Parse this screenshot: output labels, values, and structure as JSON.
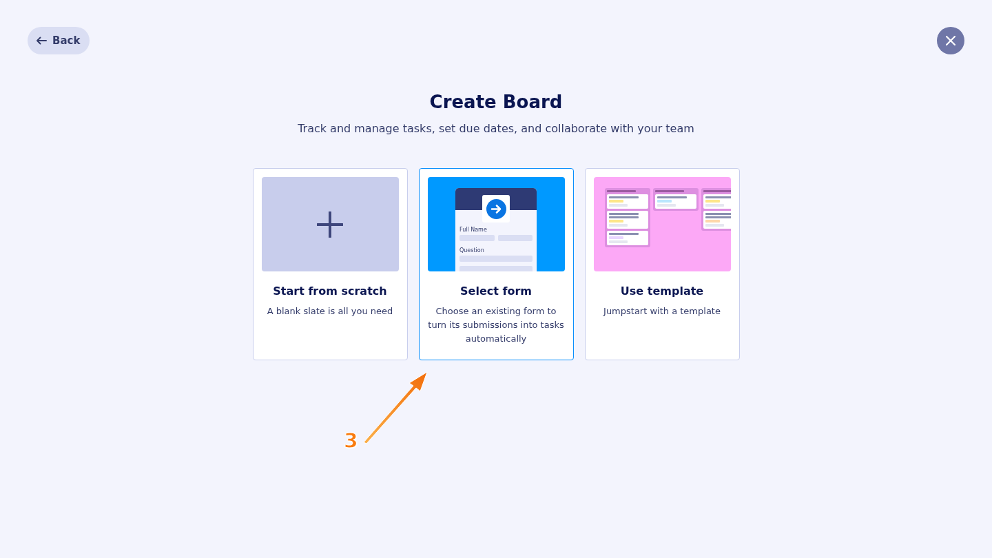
{
  "back_button": {
    "label": "Back"
  },
  "title": "Create Board",
  "subtitle": "Track and manage tasks, set due dates, and collaborate with your team",
  "options": [
    {
      "kind": "scratch",
      "title": "Start from scratch",
      "description": "A blank slate is all you need",
      "selected": false
    },
    {
      "kind": "form",
      "title": "Select form",
      "description": "Choose an existing form to turn its submissions into tasks automatically",
      "selected": true,
      "preview": {
        "fields": [
          "Full Name",
          "Question"
        ]
      }
    },
    {
      "kind": "template",
      "title": "Use template",
      "description": "Jumpstart with a template",
      "selected": false
    }
  ],
  "annotation": {
    "label": "3"
  }
}
